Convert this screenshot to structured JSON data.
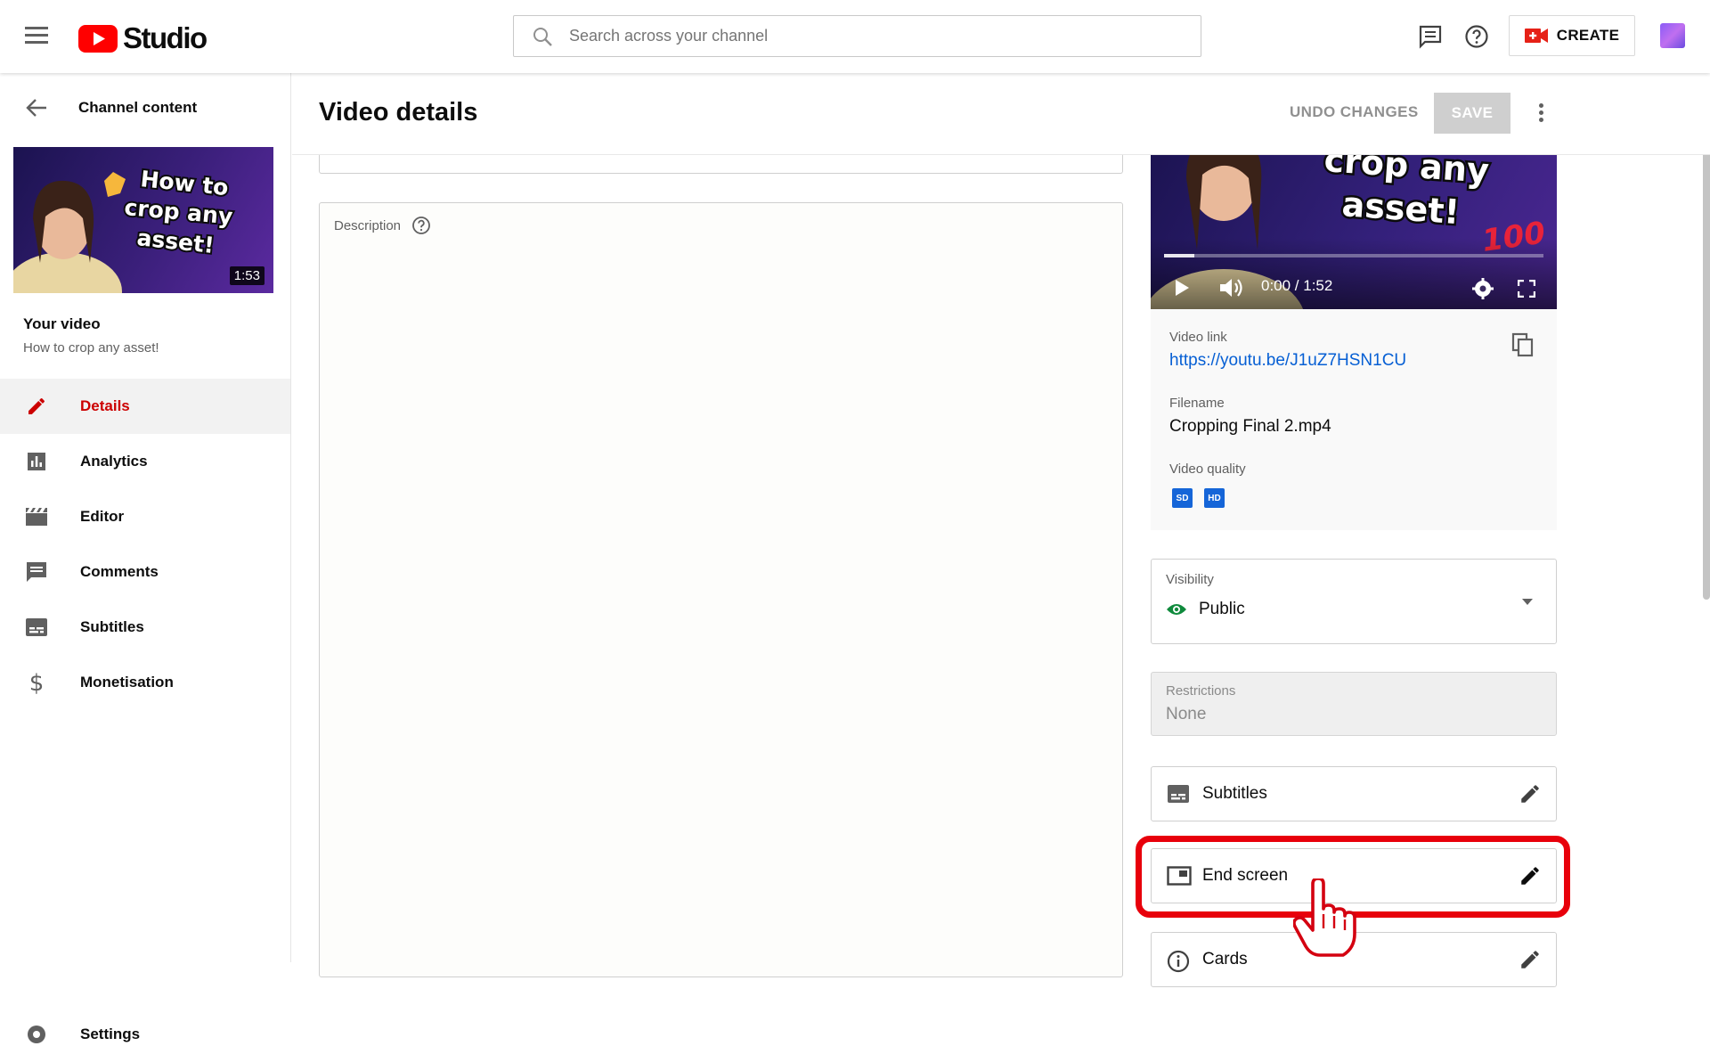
{
  "app": {
    "name": "Studio"
  },
  "search": {
    "placeholder": "Search across your channel"
  },
  "header": {
    "create_label": "CREATE"
  },
  "sidebar": {
    "back_label": "Channel content",
    "video": {
      "duration": "1:53",
      "heading": "Your video",
      "title": "How to crop any asset!",
      "thumb_text": [
        "How to",
        "crop any",
        "asset!"
      ]
    },
    "items": [
      {
        "label": "Details",
        "icon": "pencil-icon",
        "active": true
      },
      {
        "label": "Analytics",
        "icon": "analytics-icon",
        "active": false
      },
      {
        "label": "Editor",
        "icon": "clapperboard-icon",
        "active": false
      },
      {
        "label": "Comments",
        "icon": "comments-icon",
        "active": false
      },
      {
        "label": "Subtitles",
        "icon": "subtitles-icon",
        "active": false
      },
      {
        "label": "Monetisation",
        "icon": "dollar-icon",
        "active": false
      }
    ],
    "settings_label": "Settings"
  },
  "page": {
    "title": "Video details",
    "undo_label": "UNDO CHANGES",
    "save_label": "SAVE",
    "description_label": "Description"
  },
  "player": {
    "overlay_text": [
      "crop any",
      "asset!"
    ],
    "time": "0:00 / 1:52",
    "progress": 0.08
  },
  "video_info": {
    "link_label": "Video link",
    "link": "https://youtu.be/J1uZ7HSN1CU",
    "filename_label": "Filename",
    "filename": "Cropping Final 2.mp4",
    "quality_label": "Video quality",
    "qualities": [
      "SD",
      "HD"
    ]
  },
  "visibility": {
    "label": "Visibility",
    "value": "Public"
  },
  "restrictions": {
    "label": "Restrictions",
    "value": "None"
  },
  "options": {
    "subtitles": "Subtitles",
    "end_screen": "End screen",
    "cards": "Cards"
  },
  "colors": {
    "brand_red": "#ff0000",
    "active_red": "#cc0000",
    "link_blue": "#065fd4",
    "highlight": "#e8000b",
    "public_green": "#0f8a3c"
  }
}
